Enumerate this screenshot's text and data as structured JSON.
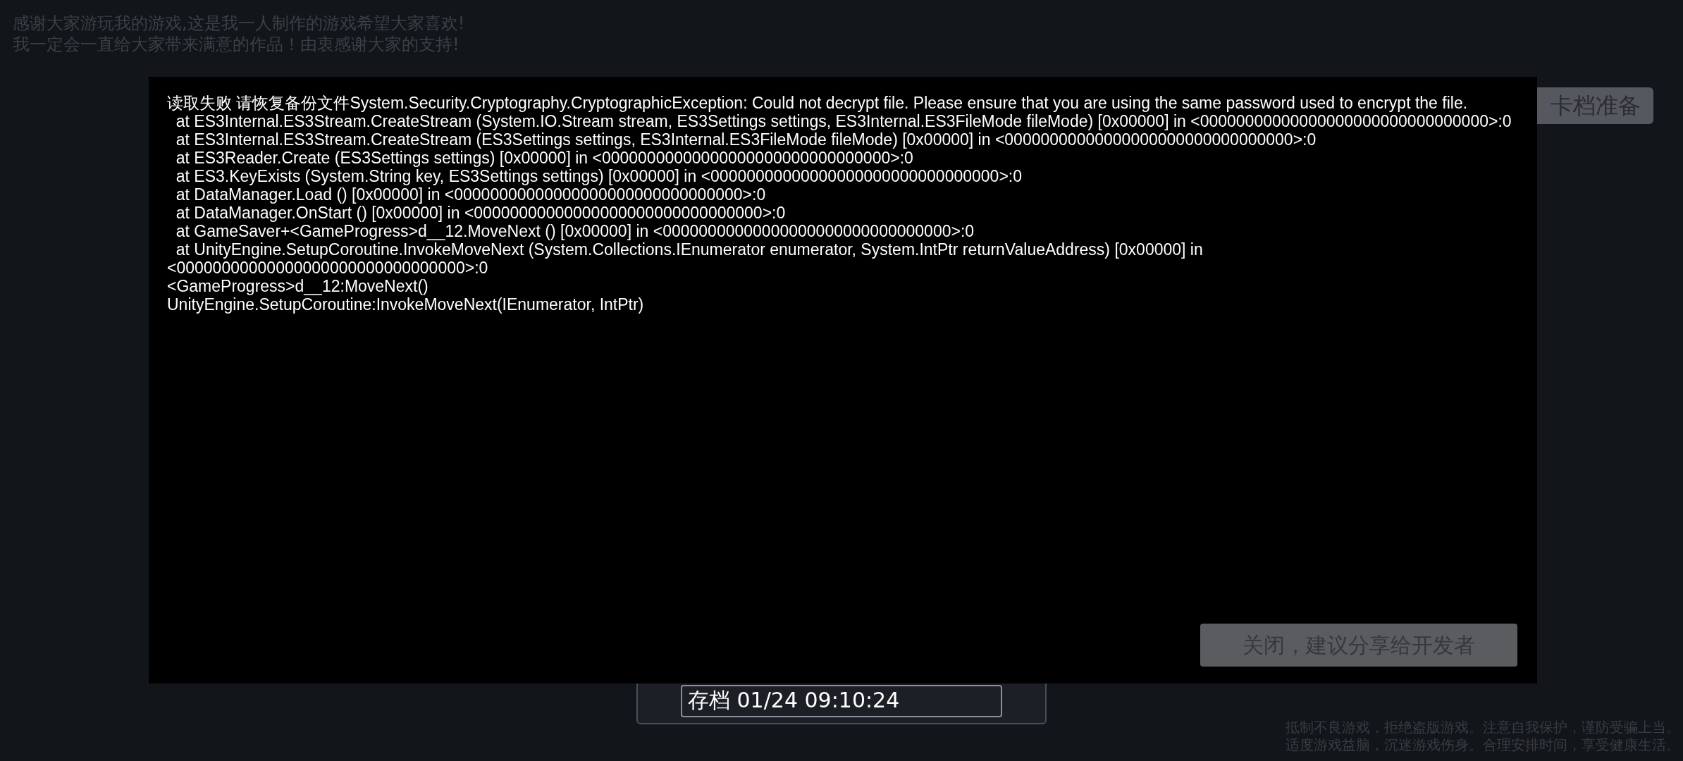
{
  "intro_text": [
    "感谢大家游玩我的游戏,这是我一人制作的游戏希望大家喜欢!",
    "我一定会一直给大家带来满意的作品！由衷感谢大家的支持!"
  ],
  "top_button": {
    "label": "卡档准备"
  },
  "save_slot": {
    "label": "存档 01/24 09:10:24"
  },
  "footer_notice": [
    "抵制不良游戏，拒绝盗版游戏。注意自我保护，谨防受骗上当。",
    "适度游戏益脑，沉迷游戏伤身。合理安排时间，享受健康生活。"
  ],
  "error_dialog": {
    "lines": [
      "读取失败 请恢复备份文件System.Security.Cryptography.CryptographicException: Could not decrypt file. Please ensure that you are using the same password used to encrypt the file.",
      "  at ES3Internal.ES3Stream.CreateStream (System.IO.Stream stream, ES3Settings settings, ES3Internal.ES3FileMode fileMode) [0x00000] in <00000000000000000000000000000000>:0",
      "  at ES3Internal.ES3Stream.CreateStream (ES3Settings settings, ES3Internal.ES3FileMode fileMode) [0x00000] in <00000000000000000000000000000000>:0",
      "  at ES3Reader.Create (ES3Settings settings) [0x00000] in <00000000000000000000000000000000>:0",
      "  at ES3.KeyExists (System.String key, ES3Settings settings) [0x00000] in <00000000000000000000000000000000>:0",
      "  at DataManager.Load () [0x00000] in <00000000000000000000000000000000>:0",
      "  at DataManager.OnStart () [0x00000] in <00000000000000000000000000000000>:0",
      "  at GameSaver+<GameProgress>d__12.MoveNext () [0x00000] in <00000000000000000000000000000000>:0",
      "  at UnityEngine.SetupCoroutine.InvokeMoveNext (System.Collections.IEnumerator enumerator, System.IntPtr returnValueAddress) [0x00000] in",
      "<00000000000000000000000000000000>:0",
      "<GameProgress>d__12:MoveNext()",
      "UnityEngine.SetupCoroutine:InvokeMoveNext(IEnumerator, IntPtr)"
    ],
    "button": {
      "label": "关闭，建议分享给开发者"
    }
  }
}
